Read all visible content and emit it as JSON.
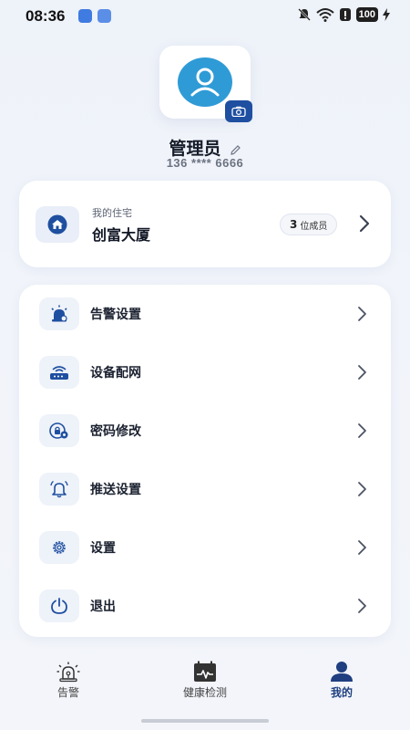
{
  "status_bar": {
    "time": "08:36",
    "battery": "100"
  },
  "profile": {
    "username": "管理员",
    "phone": "136 **** 6666"
  },
  "home": {
    "label": "我的住宅",
    "name": "创富大厦",
    "member_count": "3",
    "member_suffix": "位成员"
  },
  "menu": {
    "items": [
      {
        "label": "告警设置",
        "icon": "alarm-light-icon"
      },
      {
        "label": "设备配网",
        "icon": "router-icon"
      },
      {
        "label": "密码修改",
        "icon": "lock-settings-icon"
      },
      {
        "label": "推送设置",
        "icon": "bell-icon"
      },
      {
        "label": "设置",
        "icon": "gear-icon"
      },
      {
        "label": "退出",
        "icon": "power-icon"
      }
    ]
  },
  "bottom_nav": {
    "items": [
      {
        "label": "告警",
        "icon": "alarm-light-icon",
        "active": false
      },
      {
        "label": "健康检测",
        "icon": "calendar-pulse-icon",
        "active": false
      },
      {
        "label": "我的",
        "icon": "person-icon",
        "active": true
      }
    ]
  },
  "colors": {
    "accent": "#1f4fa0",
    "avatar_blue": "#2f9bd6",
    "background": "#f1f4fa",
    "card": "#ffffff"
  }
}
